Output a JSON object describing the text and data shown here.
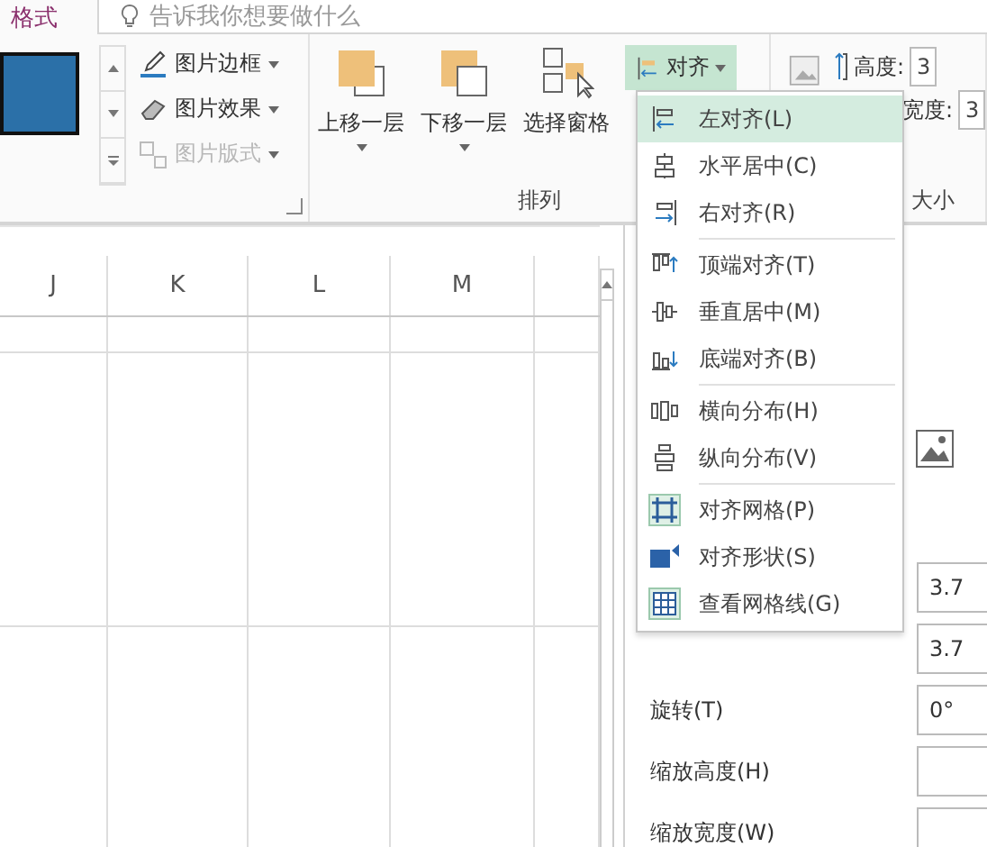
{
  "tabs": [
    {
      "label": "格式",
      "selected": true
    }
  ],
  "tell_me": {
    "placeholder": "告诉我你想要做什么"
  },
  "picture_styles": {
    "commands": [
      {
        "label": "图片边框",
        "disabled": false
      },
      {
        "label": "图片效果",
        "disabled": false
      },
      {
        "label": "图片版式",
        "disabled": true
      }
    ]
  },
  "arrange": {
    "label": "排列",
    "buttons": [
      {
        "label": "上移一层",
        "dropdown": true
      },
      {
        "label": "下移一层",
        "dropdown": true
      },
      {
        "label": "选择窗格",
        "dropdown": false
      }
    ],
    "align_button": {
      "label": "对齐",
      "expanded": true
    }
  },
  "size": {
    "label": "大小",
    "fields": [
      {
        "label": "高度:",
        "value": "3"
      },
      {
        "label": "宽度:",
        "value": "3"
      }
    ]
  },
  "sheet": {
    "columns": [
      "J",
      "K",
      "L",
      "M"
    ]
  },
  "format_pane": {
    "rows": [
      {
        "value": "3.7"
      },
      {
        "value": "3.7"
      },
      {
        "label": "旋转(T)",
        "value": "0°"
      },
      {
        "label": "缩放高度(H)"
      },
      {
        "label": "缩放宽度(W)"
      }
    ]
  },
  "align_menu": {
    "groups": [
      {
        "items": [
          {
            "label": "左对齐(L)",
            "selected": true
          },
          {
            "label": "水平居中(C)",
            "selected": false
          },
          {
            "label": "右对齐(R)",
            "selected": false
          }
        ]
      },
      {
        "items": [
          {
            "label": "顶端对齐(T)",
            "selected": false
          },
          {
            "label": "垂直居中(M)",
            "selected": false
          },
          {
            "label": "底端对齐(B)",
            "selected": false
          }
        ]
      },
      {
        "items": [
          {
            "label": "横向分布(H)",
            "selected": false
          },
          {
            "label": "纵向分布(V)",
            "selected": false
          }
        ]
      },
      {
        "items": [
          {
            "label": "对齐网格(P)",
            "selected": false
          },
          {
            "label": "对齐形状(S)",
            "selected": false
          },
          {
            "label": "查看网格线(G)",
            "selected": false
          }
        ]
      }
    ]
  }
}
